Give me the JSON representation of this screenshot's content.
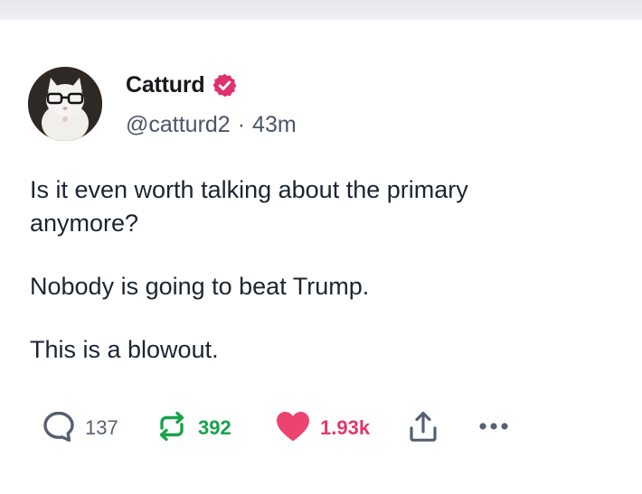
{
  "author": {
    "display_name": "Catturd",
    "handle": "@catturd2",
    "separator": "·",
    "time": "43m",
    "verified": true,
    "verified_color": "#e0306e"
  },
  "post": {
    "paragraphs": [
      "Is it even worth talking about the primary anymore?",
      "Nobody is going to beat Trump.",
      "This is a blowout."
    ]
  },
  "actions": {
    "reply": {
      "icon": "reply-icon",
      "count": "137",
      "color": "#566070"
    },
    "repost": {
      "icon": "repost-icon",
      "count": "392",
      "color": "#16a34a"
    },
    "like": {
      "icon": "heart-icon",
      "count": "1.93k",
      "color": "#e1386b",
      "liked": true
    },
    "share": {
      "icon": "share-icon"
    },
    "more": {
      "icon": "more-icon"
    }
  }
}
